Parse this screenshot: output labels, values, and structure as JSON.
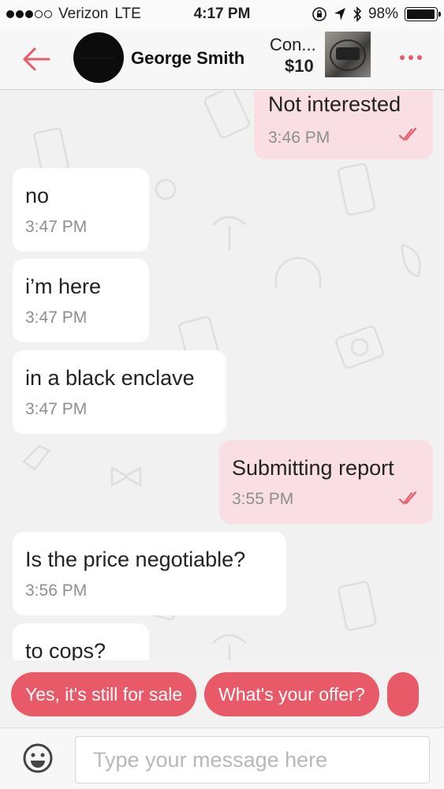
{
  "status_bar": {
    "carrier": "Verizon",
    "network": "LTE",
    "time": "4:17 PM",
    "battery": "98%",
    "battery_level": 0.98
  },
  "header": {
    "contact_name": "George Smith",
    "item_title": "Con...",
    "item_price": "$10",
    "accent_color": "#e85a68"
  },
  "messages": [
    {
      "direction": "outgoing",
      "text": "Not interested",
      "time": "3:46 PM",
      "read": true
    },
    {
      "direction": "incoming",
      "text": "no",
      "time": "3:47 PM"
    },
    {
      "direction": "incoming",
      "text": "i’m here",
      "time": "3:47 PM"
    },
    {
      "direction": "incoming",
      "text": "in a black enclave",
      "time": "3:47 PM"
    },
    {
      "direction": "outgoing",
      "text": "Submitting report",
      "time": "3:55 PM",
      "read": true
    },
    {
      "direction": "incoming",
      "text": "Is the price negotiable?",
      "time": "3:56 PM"
    },
    {
      "direction": "incoming",
      "text": "to cops?",
      "time": ""
    }
  ],
  "quick_replies": [
    {
      "label": "Yes, it's still for sale"
    },
    {
      "label": "What's your offer?"
    }
  ],
  "composer": {
    "placeholder": "Type your message here",
    "value": ""
  }
}
